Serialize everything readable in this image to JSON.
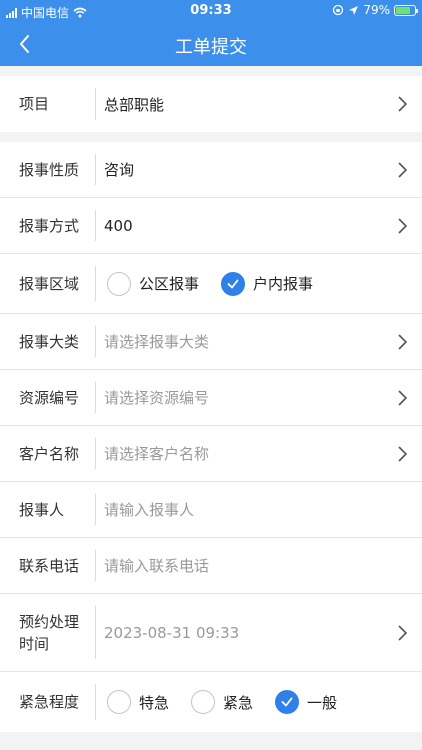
{
  "status": {
    "carrier": "中国电信",
    "time": "09:33",
    "battery": "79%",
    "battery_level": 0.79
  },
  "nav": {
    "title": "工单提交",
    "back_icon": "chevron-left-icon"
  },
  "project": {
    "label": "项目",
    "value": "总部职能"
  },
  "form": {
    "nature": {
      "label": "报事性质",
      "value": "咨询"
    },
    "method": {
      "label": "报事方式",
      "value": "400"
    },
    "area": {
      "label": "报事区域",
      "options": [
        "公区报事",
        "户内报事"
      ],
      "selected": "户内报事"
    },
    "category": {
      "label": "报事大类",
      "placeholder": "请选择报事大类"
    },
    "resource": {
      "label": "资源编号",
      "placeholder": "请选择资源编号"
    },
    "customer": {
      "label": "客户名称",
      "placeholder": "请选择客户名称"
    },
    "reporter": {
      "label": "报事人",
      "placeholder": "请输入报事人"
    },
    "phone": {
      "label": "联系电话",
      "placeholder": "请输入联系电话"
    },
    "appointment": {
      "label": "预约处理时间",
      "value": "2023-08-31 09:33"
    },
    "urgency": {
      "label": "紧急程度",
      "options": [
        "特急",
        "紧急",
        "一般"
      ],
      "selected": "一般"
    }
  },
  "colors": {
    "primary": "#3d8fec",
    "radio_checked": "#2f80e8"
  }
}
